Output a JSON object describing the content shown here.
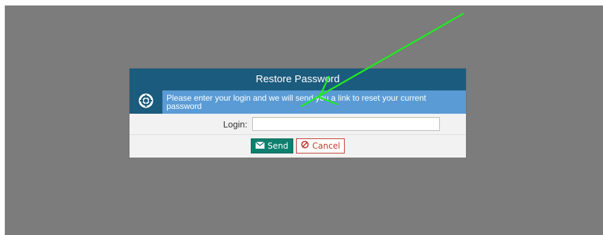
{
  "dialog": {
    "title": "Restore Password",
    "info_text": "Please enter your login and we will send you a link to reset your current password",
    "login_label": "Login:",
    "login_value": "",
    "login_placeholder": "",
    "send_label": "Send",
    "cancel_label": "Cancel"
  },
  "icons": {
    "info": "lifebuoy-icon",
    "send": "envelope-icon",
    "cancel": "ban-icon"
  },
  "colors": {
    "backdrop": "#7b7c7b",
    "header": "#1b5b7e",
    "info_bar": "#5a9bd5",
    "send_button": "#0f7f6e",
    "cancel_border": "#c0392b",
    "annotation_arrow": "#22e822"
  }
}
